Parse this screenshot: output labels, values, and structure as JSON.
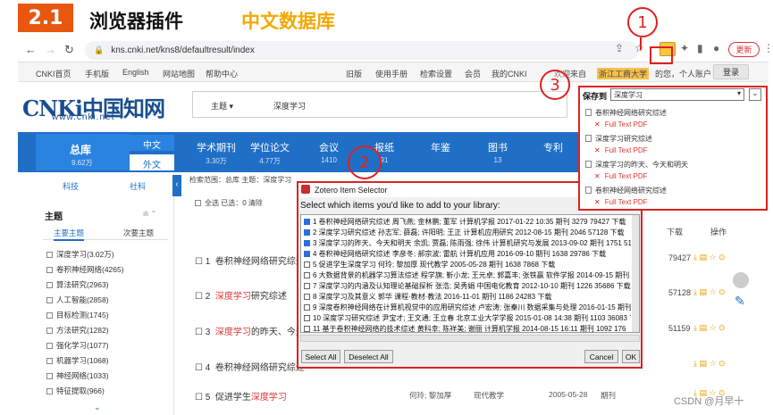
{
  "slide": {
    "section": "2.1",
    "title": "浏览器插件",
    "subtitle": "中文数据库"
  },
  "browser": {
    "url": "kns.cnki.net/kns8/defaultresult/index",
    "update_label": "更新",
    "icons": [
      "back-icon",
      "forward-icon",
      "reload-icon",
      "share-icon",
      "star-icon",
      "zotero-icon",
      "extension-icon",
      "sidepanel-icon",
      "profile-icon",
      "menu-icon"
    ]
  },
  "toplinks": {
    "items": [
      "CNKI首页",
      "手机版",
      "English",
      "网站地图",
      "帮助中心"
    ],
    "right_items": [
      "旧版",
      "使用手册",
      "检索设置",
      "会员",
      "我的CNKI"
    ],
    "welcome": "欢迎来自",
    "org": "浙江工商大学",
    "org_suffix": "的您，个人账户",
    "login": "登录"
  },
  "logo": {
    "name": "CNKi中国知网",
    "url": "www.cnki.net"
  },
  "search": {
    "field": "主题",
    "term": "深度学习"
  },
  "nav": {
    "zongku": "总库",
    "zongku_count": "9.62万",
    "zhongwen": "中文",
    "waiwen": "外文",
    "tabs": [
      {
        "label": "学术期刊",
        "count": "3.30万"
      },
      {
        "label": "学位论文",
        "count": "4.77万"
      },
      {
        "label": "会议",
        "count": "1410"
      },
      {
        "label": "报纸",
        "count": "91"
      },
      {
        "label": "年鉴",
        "count": ""
      },
      {
        "label": "图书",
        "count": "13"
      },
      {
        "label": "专利",
        "count": ""
      }
    ]
  },
  "sidebar": {
    "tabs": [
      "科技",
      "社科"
    ],
    "heading": "主题",
    "subtabs": [
      "主要主题",
      "次要主题"
    ],
    "items": [
      "深度学习(3.02万)",
      "卷积神经网络(4265)",
      "算法研究(2963)",
      "人工智能(2858)",
      "目标检测(1745)",
      "方法研究(1282)",
      "强化学习(1077)",
      "机器学习(1068)",
      "神经网络(1033)",
      "特征提取(966)"
    ]
  },
  "results": {
    "scope": "检索范围：总库   主题：深度学习",
    "ops": "全选  已选：0  清除",
    "headers": {
      "downloads": "下载",
      "ops": "操作"
    },
    "rows": [
      {
        "num": "1",
        "title_pre": "卷积神经网络研究综述",
        "hl": "",
        "title_post": "",
        "dl": "79427"
      },
      {
        "num": "2",
        "title_pre": "",
        "hl": "深度学习",
        "title_post": "研究综述",
        "dl": "57128"
      },
      {
        "num": "3",
        "title_pre": "",
        "hl": "深度学习",
        "title_post": "的昨天、今天",
        "dl": "51159"
      },
      {
        "num": "4",
        "title_pre": "卷积神经网络研究综述",
        "hl": "",
        "title_post": "",
        "dl": ""
      },
      {
        "num": "5",
        "title_pre": "促进学生",
        "hl": "深度学习",
        "title_post": "",
        "dl": ""
      }
    ],
    "row5_extra": {
      "author": "何玲; 黎加厚",
      "source": "现代教学",
      "date": "2005-05-28",
      "type": "期刊"
    }
  },
  "zotero_dialog": {
    "title": "Zotero Item Selector",
    "prompt": "Select which items you'd like to add to your library:",
    "items": [
      {
        "checked": true,
        "text": "1 卷积神经网络研究综述 周飞燕; 金林鹏; 董军 计算机学报 2017-01-22 10:35 期刊 3279 79427 下载"
      },
      {
        "checked": true,
        "text": "2 深度学习研究综述 孙志军; 薛磊; 许阳明; 王正 计算机应用研究 2012-08-15 期刊 2046 57128 下载"
      },
      {
        "checked": true,
        "text": "3 深度学习的昨天、今天和明天 余凯; 贾磊; 陈雨强; 徐伟 计算机研究与发展 2013-09-02 期刊 1751 51159 下载"
      },
      {
        "checked": true,
        "text": "4 卷积神经网络研究综述 李彦冬; 郝宗波; 雷航 计算机应用 2016-09-10 期刊 1638 29786 下载"
      },
      {
        "checked": false,
        "text": "5 促进学生深度学习 何玲; 黎加厚 现代教学 2005-05-28 期刊 1638 7868 下载"
      },
      {
        "checked": false,
        "text": "6 大数据背景的机器学习算法综述 程学旗; 靳小龙; 王元卓; 郭嘉丰; 张铁赢 软件学报 2014-09-15 期刊 1381 65"
      },
      {
        "checked": false,
        "text": "7 深度学习的内涵及认知理论基础探析 张浩; 吴秀娟 中国电化教育 2012-10-10 期刊 1226 35686 下载"
      },
      {
        "checked": false,
        "text": "8 深度学习及其意义 郭华 课程·教材·教法 2016-11-01 期刊 1186 24283 下载"
      },
      {
        "checked": false,
        "text": "9 深度卷积神经网络在计算机视觉中的应用研究综述 卢宏涛; 张秦川 数据采集与处理 2016-01-15 期刊 1"
      },
      {
        "checked": false,
        "text": "10 深度学习研究综述 尹宝才; 王文通; 王立春 北京工业大学学报 2015-01-08 14:38 期刊 1103 36083 下"
      },
      {
        "checked": false,
        "text": "11 基于卷积神经网络的技术综述 黄科幸; 陈祥美; 谢丽 计算机学报 2014-08-15 16:11 期刊 1092 176"
      }
    ],
    "select_all": "Select All",
    "deselect_all": "Deselect All",
    "cancel": "Cancel",
    "ok": "OK"
  },
  "save_panel": {
    "label": "保存到",
    "folder": "深度学习",
    "items": [
      {
        "title": "卷积神经网络研究综述",
        "pdf": "Full Text PDF"
      },
      {
        "title": "深度学习研究综述",
        "pdf": "Full Text PDF"
      },
      {
        "title": "深度学习的昨天、今天和明天",
        "pdf": "Full Text PDF"
      },
      {
        "title": "卷积神经网络研究综述",
        "pdf": "Full Text PDF"
      }
    ]
  },
  "markers": [
    "1",
    "2",
    "3"
  ],
  "watermark": "CSDN @月早十",
  "colors": {
    "accent_orange": "#e8560f",
    "title_yellow": "#f2a900",
    "cnki_blue": "#1f6fc7",
    "marker_red": "#e02020"
  }
}
